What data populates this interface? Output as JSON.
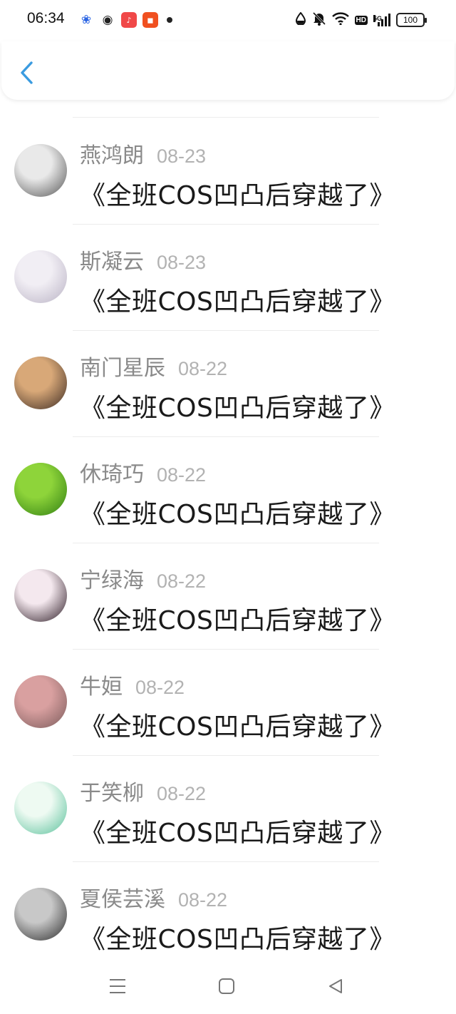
{
  "status_bar": {
    "time": "06:34",
    "battery": "100",
    "network_label": "5G",
    "hd_label": "HD"
  },
  "header": {
    "back_icon": "chevron-left-icon",
    "accent_color": "#3a9be0"
  },
  "comments": [
    {
      "username": "燕鸿朗",
      "date": "08-23",
      "message": "《全班COS凹凸后穿越了》",
      "avatar_colors": [
        "#e9e9e9",
        "#555555"
      ]
    },
    {
      "username": "斯凝云",
      "date": "08-23",
      "message": "《全班COS凹凸后穿越了》",
      "avatar_colors": [
        "#f1eef4",
        "#b9b2c4"
      ]
    },
    {
      "username": "南门星辰",
      "date": "08-22",
      "message": "《全班COS凹凸后穿越了》",
      "avatar_colors": [
        "#d8a878",
        "#3b2a22"
      ]
    },
    {
      "username": "休琦巧",
      "date": "08-22",
      "message": "《全班COS凹凸后穿越了》",
      "avatar_colors": [
        "#8ed43a",
        "#2f7d12"
      ]
    },
    {
      "username": "宁绿海",
      "date": "08-22",
      "message": "《全班COS凹凸后穿越了》",
      "avatar_colors": [
        "#f4e8ee",
        "#2b1a24"
      ]
    },
    {
      "username": "牛姮",
      "date": "08-22",
      "message": "《全班COS凹凸后穿越了》",
      "avatar_colors": [
        "#d9a0a0",
        "#7a5a5a"
      ]
    },
    {
      "username": "于笑柳",
      "date": "08-22",
      "message": "《全班COS凹凸后穿越了》",
      "avatar_colors": [
        "#eefaf2",
        "#58c09a"
      ]
    },
    {
      "username": "夏侯芸溪",
      "date": "08-22",
      "message": "《全班COS凹凸后穿越了》",
      "avatar_colors": [
        "#c8c8c8",
        "#2a2a2a"
      ]
    }
  ],
  "nav_bar": {
    "icons": [
      "menu-icon",
      "home-square-icon",
      "back-triangle-icon"
    ]
  }
}
